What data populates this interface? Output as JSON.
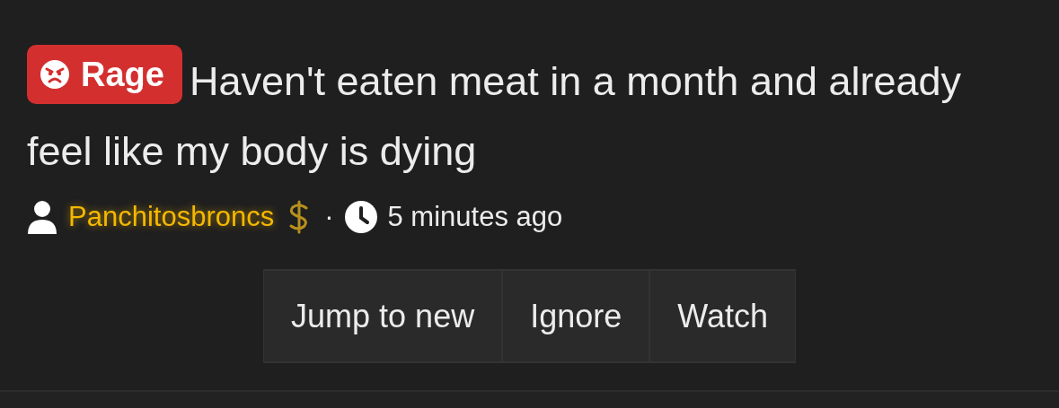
{
  "thread": {
    "prefix": {
      "label": "Rage",
      "color": "#d32f2f"
    },
    "title": "Haven't eaten meat in a month and already feel like my body is dying",
    "author": "Panchitosbroncs",
    "separator": "·",
    "time": "5 minutes ago"
  },
  "buttons": [
    {
      "label": "Jump to new"
    },
    {
      "label": "Ignore"
    },
    {
      "label": "Watch"
    }
  ]
}
